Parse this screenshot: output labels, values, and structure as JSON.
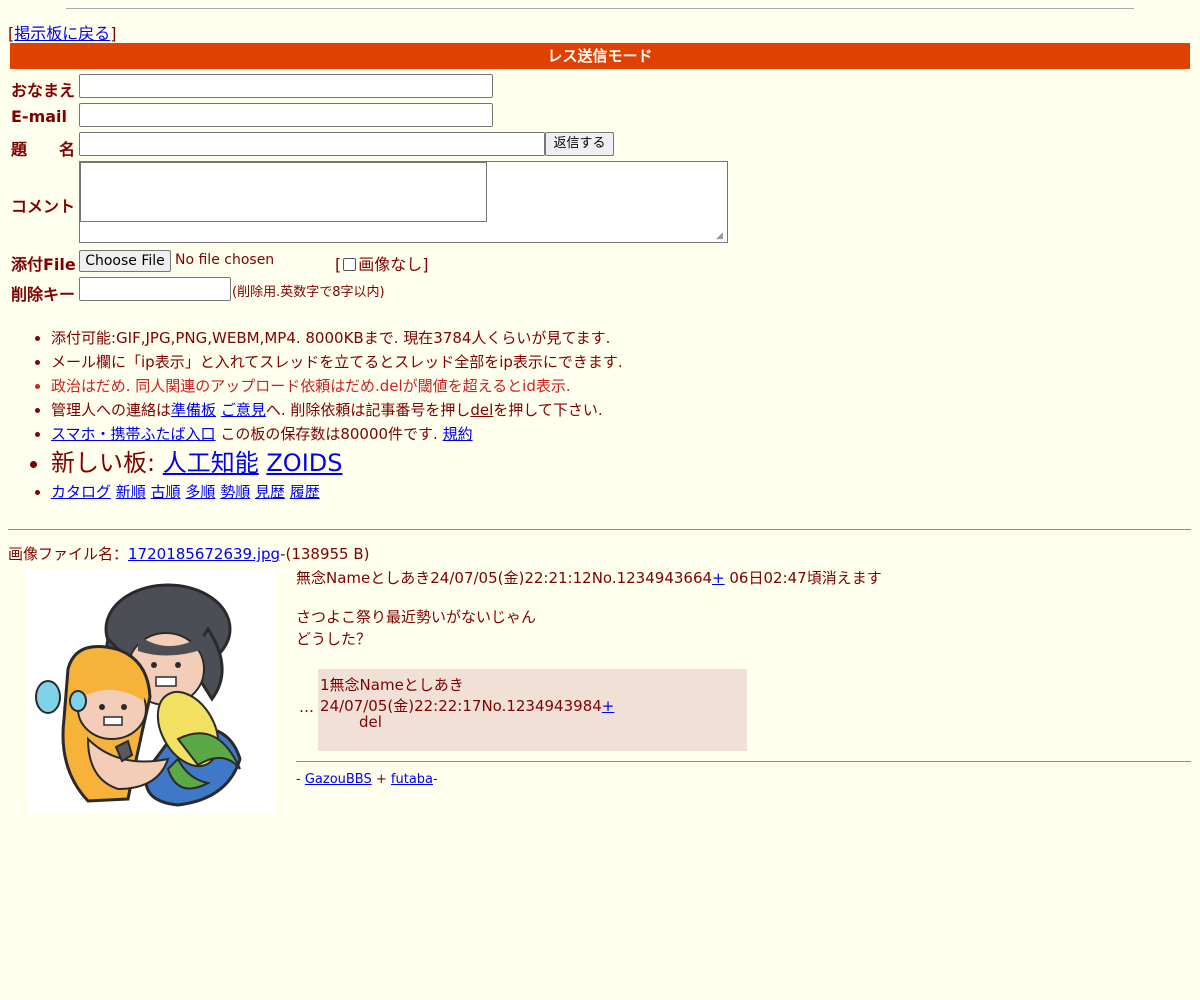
{
  "nav": {
    "back_link": "掲示板に戻る"
  },
  "form": {
    "mode_title": "レス送信モード",
    "name_label": "おなまえ",
    "email_label": "E-mail",
    "subject_label": "題　　名",
    "submit_label": "返信する",
    "comment_label": "コメント",
    "file_label": "添付File",
    "choose_file_label": "Choose File",
    "no_file_text": "No file chosen",
    "no_image_label": "画像なし",
    "delete_key_label": "削除キー",
    "delete_key_hint": "(削除用.英数字で8字以内)"
  },
  "rules": {
    "line1": "添付可能:GIF,JPG,PNG,WEBM,MP4. 8000KBまで. 現在3784人くらいが見てます.",
    "line2": "メール欄に「ip表示」と入れてスレッドを立てるとスレッド全部をip表示にできます.",
    "line3": "政治はだめ. 同人関連のアップロード依頼はだめ.delが閾値を超えるとid表示.",
    "line4_pre": "管理人への連絡は",
    "line4_link1": "準備板",
    "line4_link2": "ご意見",
    "line4_mid": "へ. 削除依頼は記事番号を押し",
    "line4_del": "del",
    "line4_post": "を押して下さい.",
    "line5_link": "スマホ・携帯ふたば入口",
    "line5_mid": " この板の保存数は80000件です. ",
    "line5_link2": "規約",
    "new_boards_label": "新しい板: ",
    "new_board1": "人工知能",
    "new_board2": "ZOIDS",
    "sort_links": [
      "カタログ",
      "新順",
      "古順",
      "多順",
      "勢順",
      "見歴",
      "履歴"
    ]
  },
  "thread": {
    "file_label": "画像ファイル名：",
    "file_name": "1720185672639.jpg",
    "file_size": "-(138955 B)",
    "op_header": "無念Nameとしあき24/07/05(金)22:21:12No.1234943664",
    "op_plus": "+",
    "op_expire": " 06日02:47頃消えます",
    "op_line1": "さつよこ祭り最近勢いがないじゃん",
    "op_line2": "どうした？",
    "omitted": "…",
    "reply_header": "1無念Nameとしあき24/07/05(金)22:22:17No.1234943984",
    "reply_plus": "+",
    "reply_body": "del"
  },
  "footer": {
    "prefix": "- ",
    "link1": "GazouBBS",
    "sep": " + ",
    "link2": "futaba",
    "suffix": "-"
  }
}
